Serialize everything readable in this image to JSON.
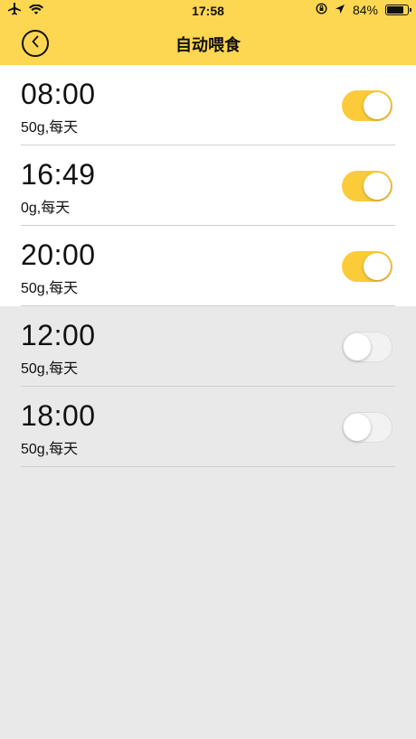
{
  "status_bar": {
    "time": "17:58",
    "battery": "84%"
  },
  "header": {
    "title": "自动喂食"
  },
  "colors": {
    "accent": "#fdd652",
    "toggle_on": "#fbcb3a"
  },
  "feedings": [
    {
      "time": "08:00",
      "detail": "50g,每天",
      "enabled": true
    },
    {
      "time": "16:49",
      "detail": "0g,每天",
      "enabled": true
    },
    {
      "time": "20:00",
      "detail": "50g,每天",
      "enabled": true
    },
    {
      "time": "12:00",
      "detail": "50g,每天",
      "enabled": false
    },
    {
      "time": "18:00",
      "detail": "50g,每天",
      "enabled": false
    }
  ]
}
